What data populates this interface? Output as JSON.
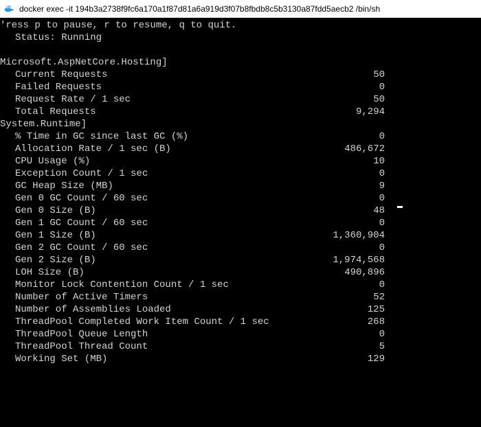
{
  "titlebar": {
    "icon_alt": "docker-whale-icon",
    "text": "docker  exec -it 194b3a2738f9fc6a170a1f87d81a6a919d3f07b8fbdb8c5b3130a87fdd5aecb2 /bin/sh"
  },
  "help_line": "'ress p to pause, r to resume, q to quit.",
  "status_label": "Status:",
  "status_value": "Running",
  "sections": [
    {
      "name": "Microsoft.AspNetCore.Hosting]",
      "rows": [
        {
          "label": "Current Requests",
          "value": "50"
        },
        {
          "label": "Failed Requests",
          "value": "0"
        },
        {
          "label": "Request Rate / 1 sec",
          "value": "50"
        },
        {
          "label": "Total Requests",
          "value": "9,294"
        }
      ]
    },
    {
      "name": "System.Runtime]",
      "rows": [
        {
          "label": "% Time in GC since last GC (%)",
          "value": "0"
        },
        {
          "label": "Allocation Rate / 1 sec (B)",
          "value": "486,672"
        },
        {
          "label": "CPU Usage (%)",
          "value": "10"
        },
        {
          "label": "Exception Count / 1 sec",
          "value": "0"
        },
        {
          "label": "GC Heap Size (MB)",
          "value": "9"
        },
        {
          "label": "Gen 0 GC Count / 60 sec",
          "value": "0"
        },
        {
          "label": "Gen 0 Size (B)",
          "value": "48"
        },
        {
          "label": "Gen 1 GC Count / 60 sec",
          "value": "0"
        },
        {
          "label": "Gen 1 Size (B)",
          "value": "1,360,904"
        },
        {
          "label": "Gen 2 GC Count / 60 sec",
          "value": "0"
        },
        {
          "label": "Gen 2 Size (B)",
          "value": "1,974,568"
        },
        {
          "label": "LOH Size (B)",
          "value": "490,896"
        },
        {
          "label": "Monitor Lock Contention Count / 1 sec",
          "value": "0"
        },
        {
          "label": "Number of Active Timers",
          "value": "52"
        },
        {
          "label": "Number of Assemblies Loaded",
          "value": "125"
        },
        {
          "label": "ThreadPool Completed Work Item Count / 1 sec",
          "value": "268"
        },
        {
          "label": "ThreadPool Queue Length",
          "value": "0"
        },
        {
          "label": "ThreadPool Thread Count",
          "value": "5"
        },
        {
          "label": "Working Set (MB)",
          "value": "129"
        }
      ]
    }
  ]
}
